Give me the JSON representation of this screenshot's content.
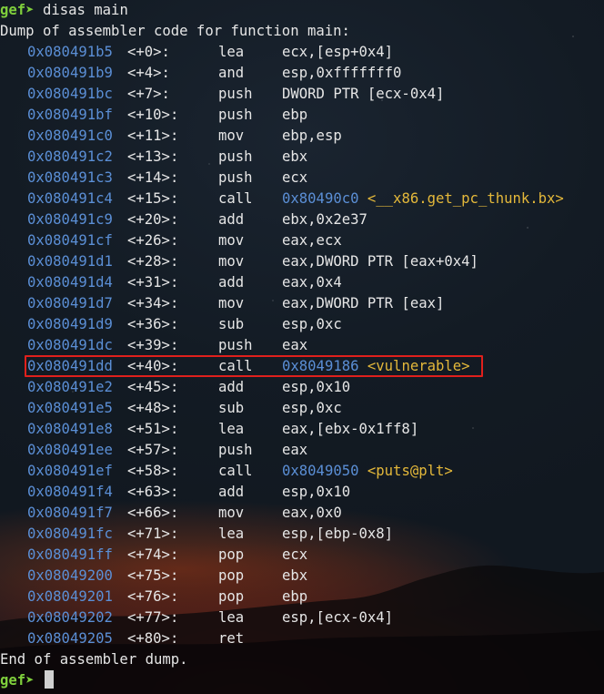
{
  "terminal": {
    "prompt_label": "gef➤",
    "command": "disas main",
    "header_text": "Dump of assembler code for function main:",
    "footer_text": "End of assembler dump.",
    "colors": {
      "prompt": "#7fcf3c",
      "address": "#5b8fd6",
      "symbol": "#e4b83a",
      "highlight_box": "#e0201c"
    },
    "highlighted_row_index": 14,
    "rows": [
      {
        "addr": "0x080491b5",
        "off": "<+0>:",
        "mn": "lea",
        "ops": "ecx,[esp+0x4]",
        "tgt": "",
        "sym": ""
      },
      {
        "addr": "0x080491b9",
        "off": "<+4>:",
        "mn": "and",
        "ops": "esp,0xfffffff0",
        "tgt": "",
        "sym": ""
      },
      {
        "addr": "0x080491bc",
        "off": "<+7>:",
        "mn": "push",
        "ops": "DWORD PTR [ecx-0x4]",
        "tgt": "",
        "sym": ""
      },
      {
        "addr": "0x080491bf",
        "off": "<+10>:",
        "mn": "push",
        "ops": "ebp",
        "tgt": "",
        "sym": ""
      },
      {
        "addr": "0x080491c0",
        "off": "<+11>:",
        "mn": "mov",
        "ops": "ebp,esp",
        "tgt": "",
        "sym": ""
      },
      {
        "addr": "0x080491c2",
        "off": "<+13>:",
        "mn": "push",
        "ops": "ebx",
        "tgt": "",
        "sym": ""
      },
      {
        "addr": "0x080491c3",
        "off": "<+14>:",
        "mn": "push",
        "ops": "ecx",
        "tgt": "",
        "sym": ""
      },
      {
        "addr": "0x080491c4",
        "off": "<+15>:",
        "mn": "call",
        "ops": "",
        "tgt": "0x80490c0",
        "sym": "<__x86.get_pc_thunk.bx>"
      },
      {
        "addr": "0x080491c9",
        "off": "<+20>:",
        "mn": "add",
        "ops": "ebx,0x2e37",
        "tgt": "",
        "sym": ""
      },
      {
        "addr": "0x080491cf",
        "off": "<+26>:",
        "mn": "mov",
        "ops": "eax,ecx",
        "tgt": "",
        "sym": ""
      },
      {
        "addr": "0x080491d1",
        "off": "<+28>:",
        "mn": "mov",
        "ops": "eax,DWORD PTR [eax+0x4]",
        "tgt": "",
        "sym": ""
      },
      {
        "addr": "0x080491d4",
        "off": "<+31>:",
        "mn": "add",
        "ops": "eax,0x4",
        "tgt": "",
        "sym": ""
      },
      {
        "addr": "0x080491d7",
        "off": "<+34>:",
        "mn": "mov",
        "ops": "eax,DWORD PTR [eax]",
        "tgt": "",
        "sym": ""
      },
      {
        "addr": "0x080491d9",
        "off": "<+36>:",
        "mn": "sub",
        "ops": "esp,0xc",
        "tgt": "",
        "sym": ""
      },
      {
        "addr": "0x080491dc",
        "off": "<+39>:",
        "mn": "push",
        "ops": "eax",
        "tgt": "",
        "sym": ""
      },
      {
        "addr": "0x080491dd",
        "off": "<+40>:",
        "mn": "call",
        "ops": "",
        "tgt": "0x8049186",
        "sym": "<vulnerable>"
      },
      {
        "addr": "0x080491e2",
        "off": "<+45>:",
        "mn": "add",
        "ops": "esp,0x10",
        "tgt": "",
        "sym": ""
      },
      {
        "addr": "0x080491e5",
        "off": "<+48>:",
        "mn": "sub",
        "ops": "esp,0xc",
        "tgt": "",
        "sym": ""
      },
      {
        "addr": "0x080491e8",
        "off": "<+51>:",
        "mn": "lea",
        "ops": "eax,[ebx-0x1ff8]",
        "tgt": "",
        "sym": ""
      },
      {
        "addr": "0x080491ee",
        "off": "<+57>:",
        "mn": "push",
        "ops": "eax",
        "tgt": "",
        "sym": ""
      },
      {
        "addr": "0x080491ef",
        "off": "<+58>:",
        "mn": "call",
        "ops": "",
        "tgt": "0x8049050",
        "sym": "<puts@plt>"
      },
      {
        "addr": "0x080491f4",
        "off": "<+63>:",
        "mn": "add",
        "ops": "esp,0x10",
        "tgt": "",
        "sym": ""
      },
      {
        "addr": "0x080491f7",
        "off": "<+66>:",
        "mn": "mov",
        "ops": "eax,0x0",
        "tgt": "",
        "sym": ""
      },
      {
        "addr": "0x080491fc",
        "off": "<+71>:",
        "mn": "lea",
        "ops": "esp,[ebp-0x8]",
        "tgt": "",
        "sym": ""
      },
      {
        "addr": "0x080491ff",
        "off": "<+74>:",
        "mn": "pop",
        "ops": "ecx",
        "tgt": "",
        "sym": ""
      },
      {
        "addr": "0x08049200",
        "off": "<+75>:",
        "mn": "pop",
        "ops": "ebx",
        "tgt": "",
        "sym": ""
      },
      {
        "addr": "0x08049201",
        "off": "<+76>:",
        "mn": "pop",
        "ops": "ebp",
        "tgt": "",
        "sym": ""
      },
      {
        "addr": "0x08049202",
        "off": "<+77>:",
        "mn": "lea",
        "ops": "esp,[ecx-0x4]",
        "tgt": "",
        "sym": ""
      },
      {
        "addr": "0x08049205",
        "off": "<+80>:",
        "mn": "ret",
        "ops": "",
        "tgt": "",
        "sym": ""
      }
    ]
  }
}
